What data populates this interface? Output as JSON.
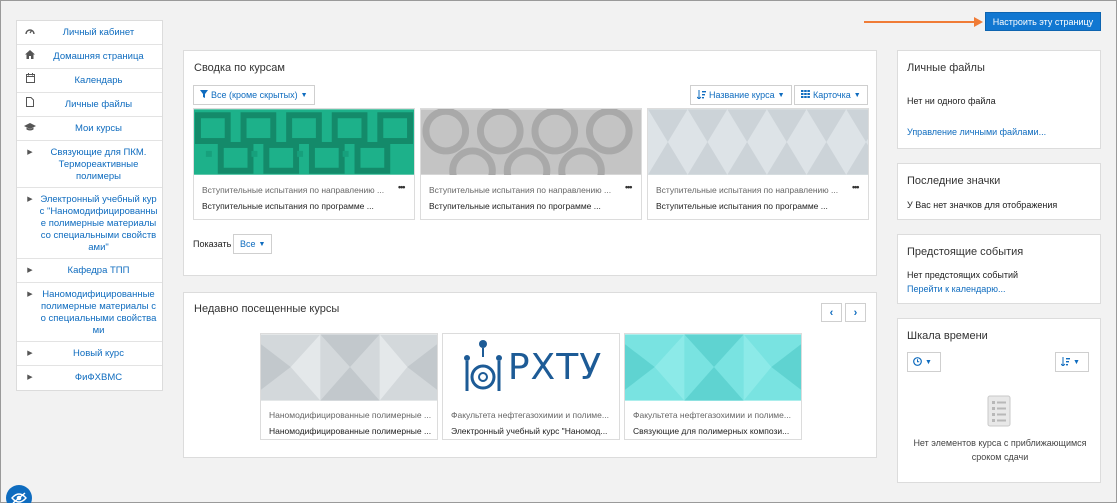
{
  "header": {
    "customize_label": "Настроить эту страницу"
  },
  "sidebar": {
    "items": [
      {
        "icon": "dashboard-icon",
        "label": "Личный кабинет"
      },
      {
        "icon": "home-icon",
        "label": "Домашняя страница"
      },
      {
        "icon": "calendar-icon",
        "label": "Календарь"
      },
      {
        "icon": "file-icon",
        "label": "Личные файлы"
      },
      {
        "icon": "graduation-cap-icon",
        "label": "Мои курсы"
      },
      {
        "icon": "caret-right-icon",
        "label": "Связующие для ПКМ. Термореактивные полимеры"
      },
      {
        "icon": "caret-right-icon",
        "label": "Электронный учебный курс \"Наномодифицированные полимерные материалы со специальными свойствами\""
      },
      {
        "icon": "caret-right-icon",
        "label": "Кафедра ТПП"
      },
      {
        "icon": "caret-right-icon",
        "label": "Наномодифицированные полимерные материалы со специальными свойствами"
      },
      {
        "icon": "caret-right-icon",
        "label": "Новый курс"
      },
      {
        "icon": "caret-right-icon",
        "label": "ФиФХВМС"
      }
    ]
  },
  "overview": {
    "title": "Сводка по курсам",
    "filter_label": "Все (кроме скрытых)",
    "sort_label": "Название курса",
    "view_label": "Карточка",
    "show_label": "Показать",
    "show_value": "Все",
    "courses": [
      {
        "category": "Вступительные испытания по направлению ...",
        "name": "Вступительные испытания по программе ..."
      },
      {
        "category": "Вступительные испытания по направлению ...",
        "name": "Вступительные испытания по программе ..."
      },
      {
        "category": "Вступительные испытания по направлению ...",
        "name": "Вступительные испытания по программе ..."
      }
    ],
    "more_label": "•••"
  },
  "recent": {
    "title": "Недавно посещенные курсы",
    "prev_label": "‹",
    "next_label": "›",
    "logo_text": "РХТУ",
    "courses": [
      {
        "category": "Наномодифицированные полимерные ...",
        "name": "Наномодифицированные полимерные ..."
      },
      {
        "category": "Факультета нефтегазохимии и полиме...",
        "name": "Электронный учебный курс \"Наномод..."
      },
      {
        "category": "Факультета нефтегазохимии и полиме...",
        "name": "Связующие для полимерных компози..."
      }
    ]
  },
  "private_files": {
    "title": "Личные файлы",
    "empty": "Нет ни одного файла",
    "manage_link": "Управление личными файлами..."
  },
  "badges": {
    "title": "Последние значки",
    "empty": "У Вас нет значков для отображения"
  },
  "events": {
    "title": "Предстоящие события",
    "empty": "Нет предстоящих событий",
    "calendar_link": "Перейти к календарю..."
  },
  "timeline": {
    "title": "Шкала времени",
    "empty_line1": "Нет элементов курса с приближающимся",
    "empty_line2": "сроком сдачи"
  },
  "colors": {
    "accent": "#0f6cbf",
    "button_blue": "#1177d1",
    "arrow": "#f07c36",
    "tile_green": "#1db18a",
    "tile_gray": "#c4c4c4",
    "tile_light": "#dde3e7",
    "tile_cyan": "#79e3e1"
  }
}
